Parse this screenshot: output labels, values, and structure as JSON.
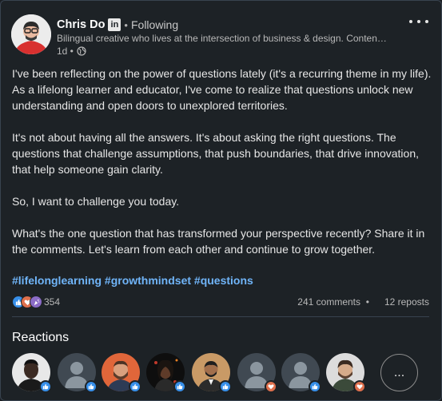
{
  "post": {
    "author_name": "Chris Do",
    "linkedin_badge": "in",
    "separator": "•",
    "follow_status": "Following",
    "headline": "Bilingual creative who lives at the intersection of business & design. Conten…",
    "time_ago": "1d •",
    "visibility_icon": "globe-icon",
    "paragraphs": [
      "I've been reflecting on the power of questions lately (it's a recurring theme in my life). As a lifelong learner and educator, I've come to realize that questions unlock new understanding and open doors to unexplored territories.",
      "It's not about having all the answers. It's about asking the right questions. The questions that challenge assumptions, that push boundaries, that drive innovation, that help someone gain clarity.",
      "So, I want to challenge you today.",
      "What's the one question that has transformed your perspective recently? Share it in the comments. Let's learn from each other and continue to grow together."
    ],
    "hashtags": [
      "#lifelonglearning",
      "#growthmindset",
      "#questions"
    ]
  },
  "social": {
    "reaction_count": "354",
    "comments": "241 comments",
    "dot": "•",
    "reposts": "12 reposts",
    "reaction_types": [
      "like",
      "love",
      "celebrate"
    ]
  },
  "reactions_panel": {
    "heading": "Reactions",
    "more_label": "...",
    "reactors": [
      {
        "avatar": "person-photo",
        "reaction": "like"
      },
      {
        "avatar": "default-avatar",
        "reaction": "like"
      },
      {
        "avatar": "person-photo",
        "reaction": "like"
      },
      {
        "avatar": "person-photo",
        "reaction": "like"
      },
      {
        "avatar": "person-photo",
        "reaction": "like"
      },
      {
        "avatar": "default-avatar",
        "reaction": "love"
      },
      {
        "avatar": "default-avatar",
        "reaction": "like"
      },
      {
        "avatar": "person-photo",
        "reaction": "love"
      }
    ]
  },
  "colors": {
    "background": "#1d2226",
    "hashtag": "#70b5f9",
    "like": "#378fe9",
    "love": "#df704d"
  }
}
